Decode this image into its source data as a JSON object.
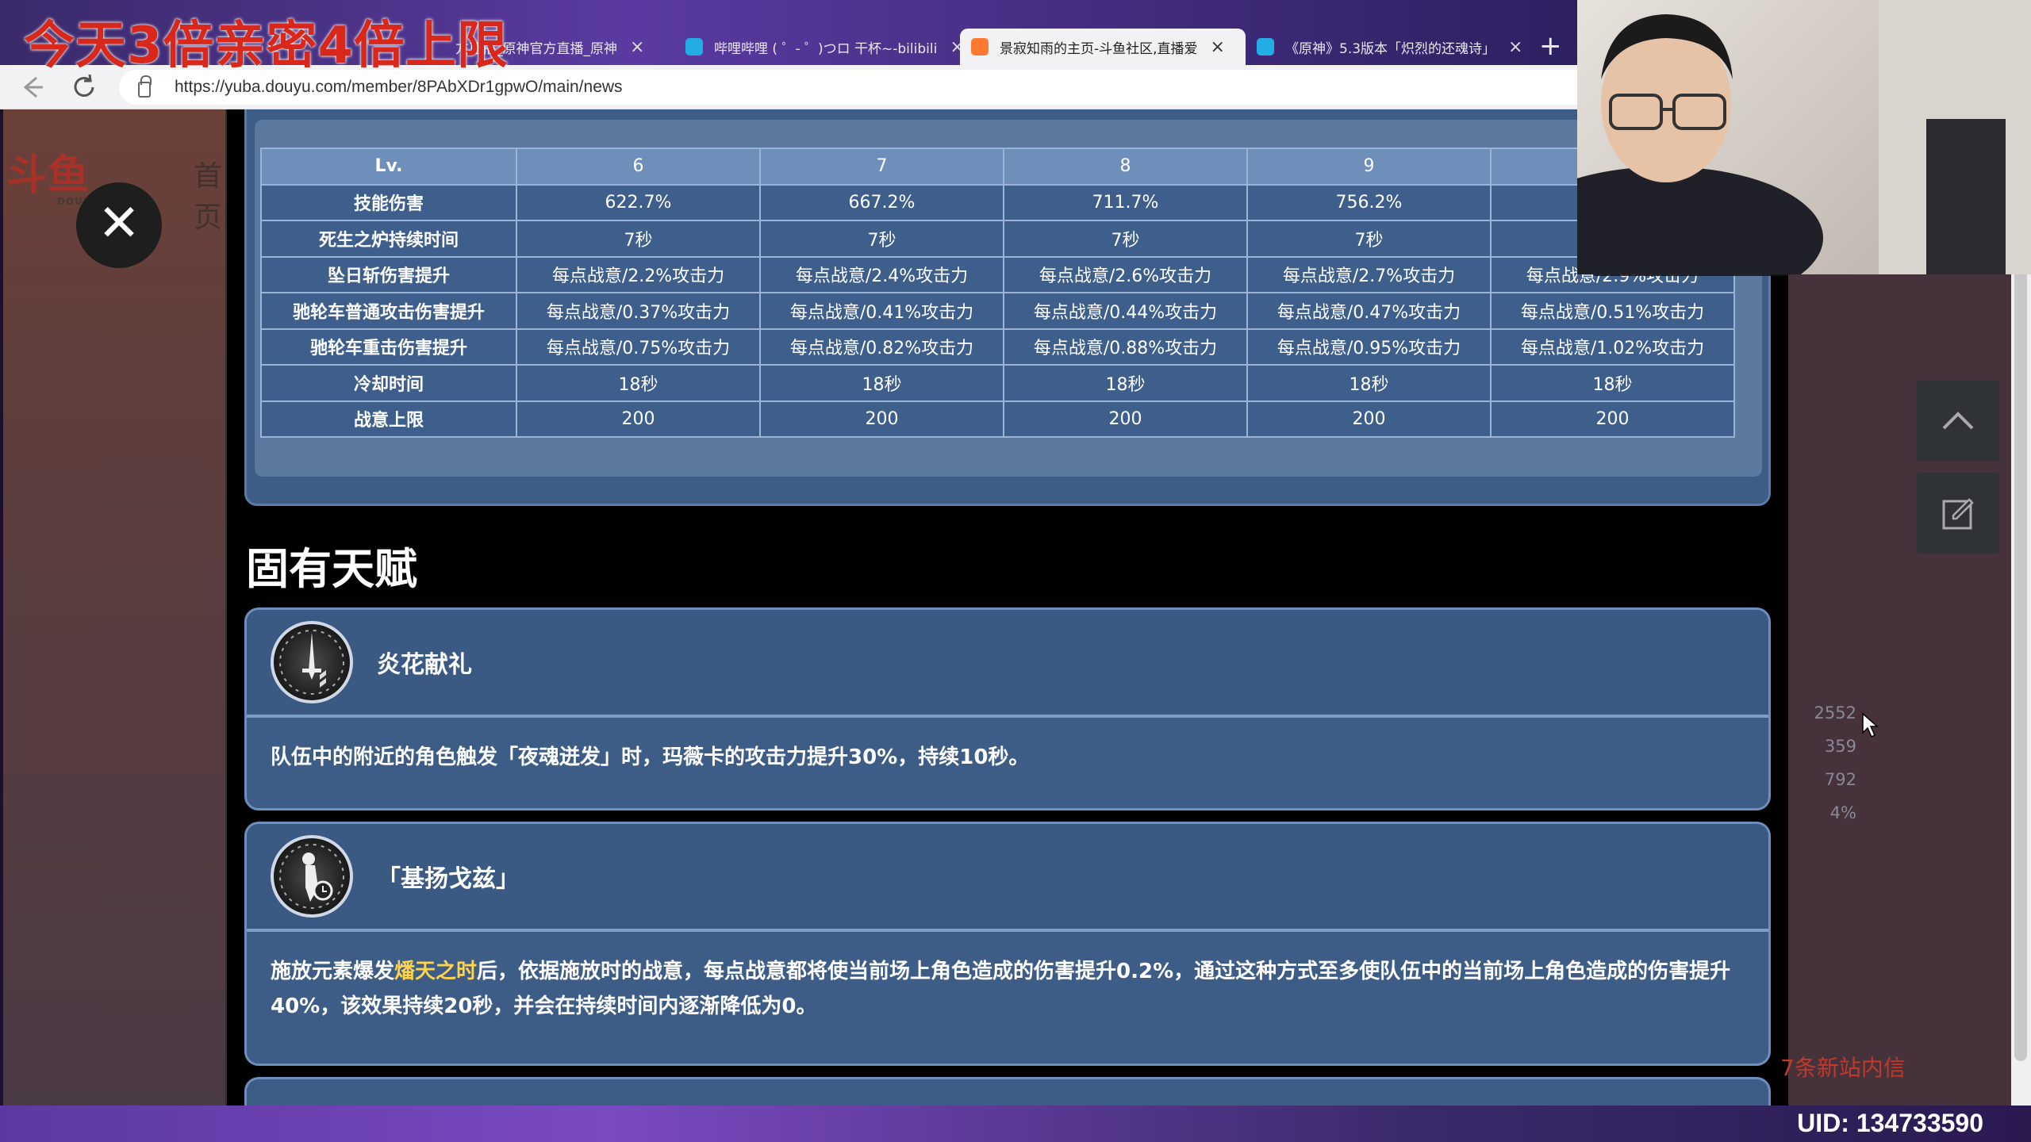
{
  "overlay": {
    "title": "今天3倍亲密4倍上限"
  },
  "browser": {
    "tabs": [
      {
        "label": "方直播_原神官方直播_原神",
        "close": "×",
        "color": "#f0a030"
      },
      {
        "label": "哔哩哔哩 ( ゜- ゜)つロ 干杯~-bilibili",
        "close": "×",
        "color": "#23ade5"
      },
      {
        "label": "景寂知雨的主页-斗鱼社区,直播爱",
        "close": "×",
        "color": "#ff7a30"
      },
      {
        "label": "《原神》5.3版本「炽烈的还魂诗」",
        "close": "×",
        "color": "#23ade5"
      }
    ],
    "new_tab": "+",
    "url": "https://yuba.douyu.com/member/8PAbXDr1gpwO/main/news"
  },
  "site": {
    "logo_text": "斗鱼",
    "logo_sub": "DOUYU.COM",
    "nav_home": "首页"
  },
  "close_label": "✕",
  "level_table": {
    "header": [
      "Lv.",
      "6",
      "7",
      "8",
      "9",
      ""
    ],
    "rows": [
      {
        "name": "技能伤害",
        "cells": [
          "622.7%",
          "667.2%",
          "711.7%",
          "756.2%",
          ""
        ]
      },
      {
        "name": "死生之炉持续时间",
        "cells": [
          "7秒",
          "7秒",
          "7秒",
          "7秒",
          ""
        ]
      },
      {
        "name": "坠日斩伤害提升",
        "cells": [
          "每点战意/2.2%攻击力",
          "每点战意/2.4%攻击力",
          "每点战意/2.6%攻击力",
          "每点战意/2.7%攻击力",
          "每点战意/2.9%攻击力"
        ]
      },
      {
        "name": "驰轮车普通攻击伤害提升",
        "cells": [
          "每点战意/0.37%攻击力",
          "每点战意/0.41%攻击力",
          "每点战意/0.44%攻击力",
          "每点战意/0.47%攻击力",
          "每点战意/0.51%攻击力"
        ]
      },
      {
        "name": "驰轮车重击伤害提升",
        "cells": [
          "每点战意/0.75%攻击力",
          "每点战意/0.82%攻击力",
          "每点战意/0.88%攻击力",
          "每点战意/0.95%攻击力",
          "每点战意/1.02%攻击力"
        ]
      },
      {
        "name": "冷却时间",
        "cells": [
          "18秒",
          "18秒",
          "18秒",
          "18秒",
          "18秒"
        ]
      },
      {
        "name": "战意上限",
        "cells": [
          "200",
          "200",
          "200",
          "200",
          "200"
        ]
      }
    ]
  },
  "section": {
    "title": "固有天赋"
  },
  "talents": [
    {
      "name": "炎花献礼",
      "desc": "队伍中的附近的角色触发「夜魂迸发」时，玛薇卡的攻击力提升30%，持续10秒。"
    },
    {
      "name": "「基扬戈兹」",
      "desc_before": "施放元素爆发",
      "desc_highlight": "燔天之时",
      "desc_after": "后，依据施放时的战意，每点战意都将使当前场上角色造成的伤害提升0.2%，通过这种方式至多使队伍中的当前场上角色造成的伤害提升40%，该效果持续20秒，并会在持续时间内逐渐降低为0。"
    }
  ],
  "stats": [
    "2552",
    "359",
    "792",
    "4%"
  ],
  "messages_link": "7条新站内信",
  "uid": "UID: 134733590",
  "icons": [
    "rotate-left-icon",
    "rotate-right-icon",
    "zoom-out-icon",
    "scroll-top-icon",
    "edit-icon",
    "close-icon",
    "lock-icon",
    "back-icon",
    "reload-icon"
  ]
}
